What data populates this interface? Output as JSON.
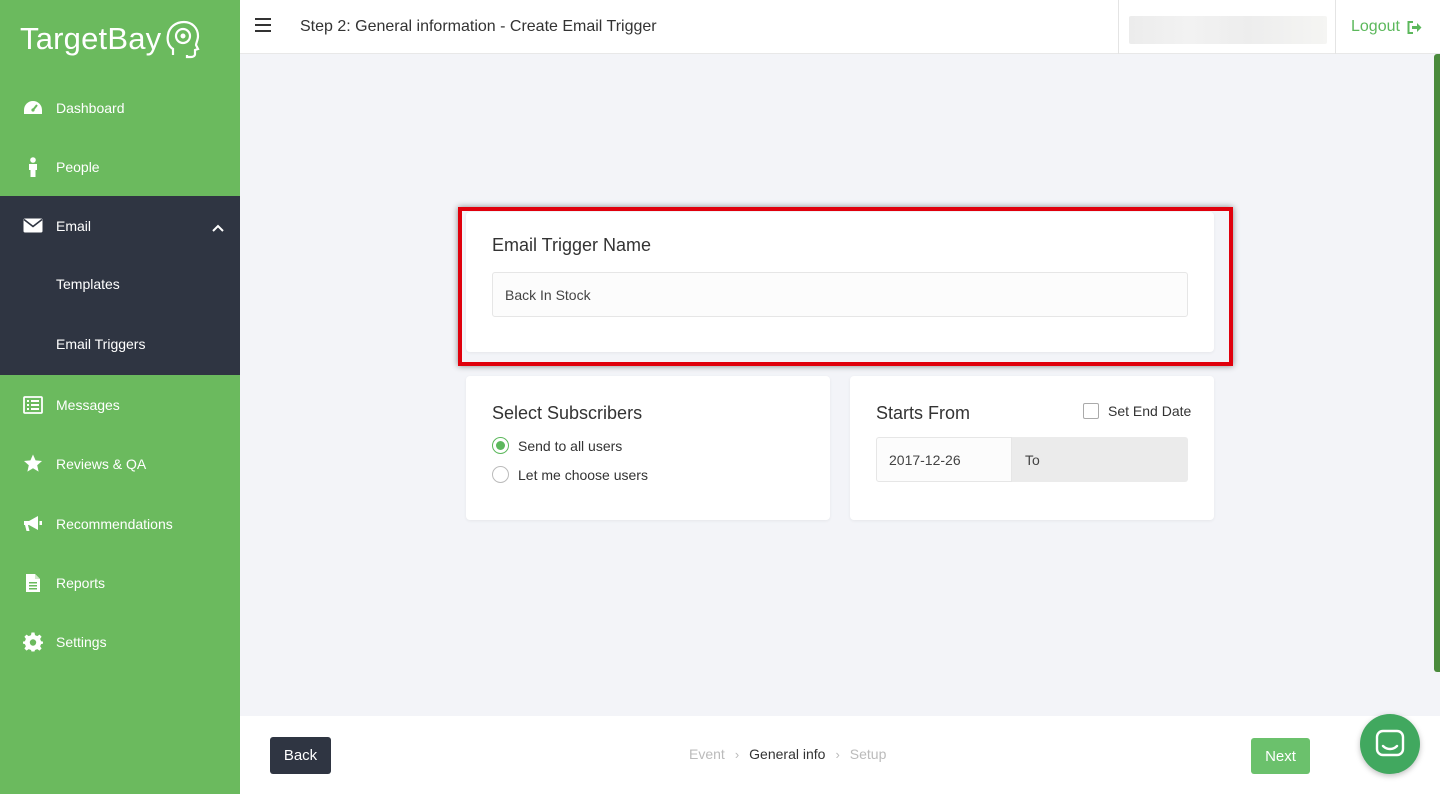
{
  "brand": {
    "name": "TargetBay",
    "accent": "#6bba5e",
    "dark": "#2f3542",
    "highlight": "#e0000c"
  },
  "sidebar": {
    "items": [
      {
        "label": "Dashboard",
        "icon": "dashboard-icon"
      },
      {
        "label": "People",
        "icon": "person-icon"
      },
      {
        "label": "Email",
        "icon": "envelope-icon"
      },
      {
        "label": "Messages",
        "icon": "messages-icon"
      },
      {
        "label": "Reviews & QA",
        "icon": "star-icon"
      },
      {
        "label": "Recommendations",
        "icon": "megaphone-icon"
      },
      {
        "label": "Reports",
        "icon": "report-icon"
      },
      {
        "label": "Settings",
        "icon": "gear-icon"
      }
    ],
    "email_subitems": [
      {
        "label": "Templates"
      },
      {
        "label": "Email Triggers"
      }
    ]
  },
  "header": {
    "title": "Step 2: General information - Create Email Trigger",
    "logout_label": "Logout"
  },
  "form": {
    "name_card": {
      "title": "Email Trigger Name",
      "value": "Back In Stock"
    },
    "subscribers_card": {
      "title": "Select Subscribers",
      "options": [
        {
          "label": "Send to all users",
          "selected": true
        },
        {
          "label": "Let me choose users",
          "selected": false
        }
      ]
    },
    "starts_card": {
      "title": "Starts From",
      "set_end_date_label": "Set End Date",
      "set_end_date_checked": false,
      "start_date": "2017-12-26",
      "to_label": "To"
    }
  },
  "footer": {
    "back_label": "Back",
    "next_label": "Next",
    "steps": [
      {
        "label": "Event",
        "state": "done"
      },
      {
        "label": "General info",
        "state": "active"
      },
      {
        "label": "Setup",
        "state": "pending"
      }
    ]
  }
}
